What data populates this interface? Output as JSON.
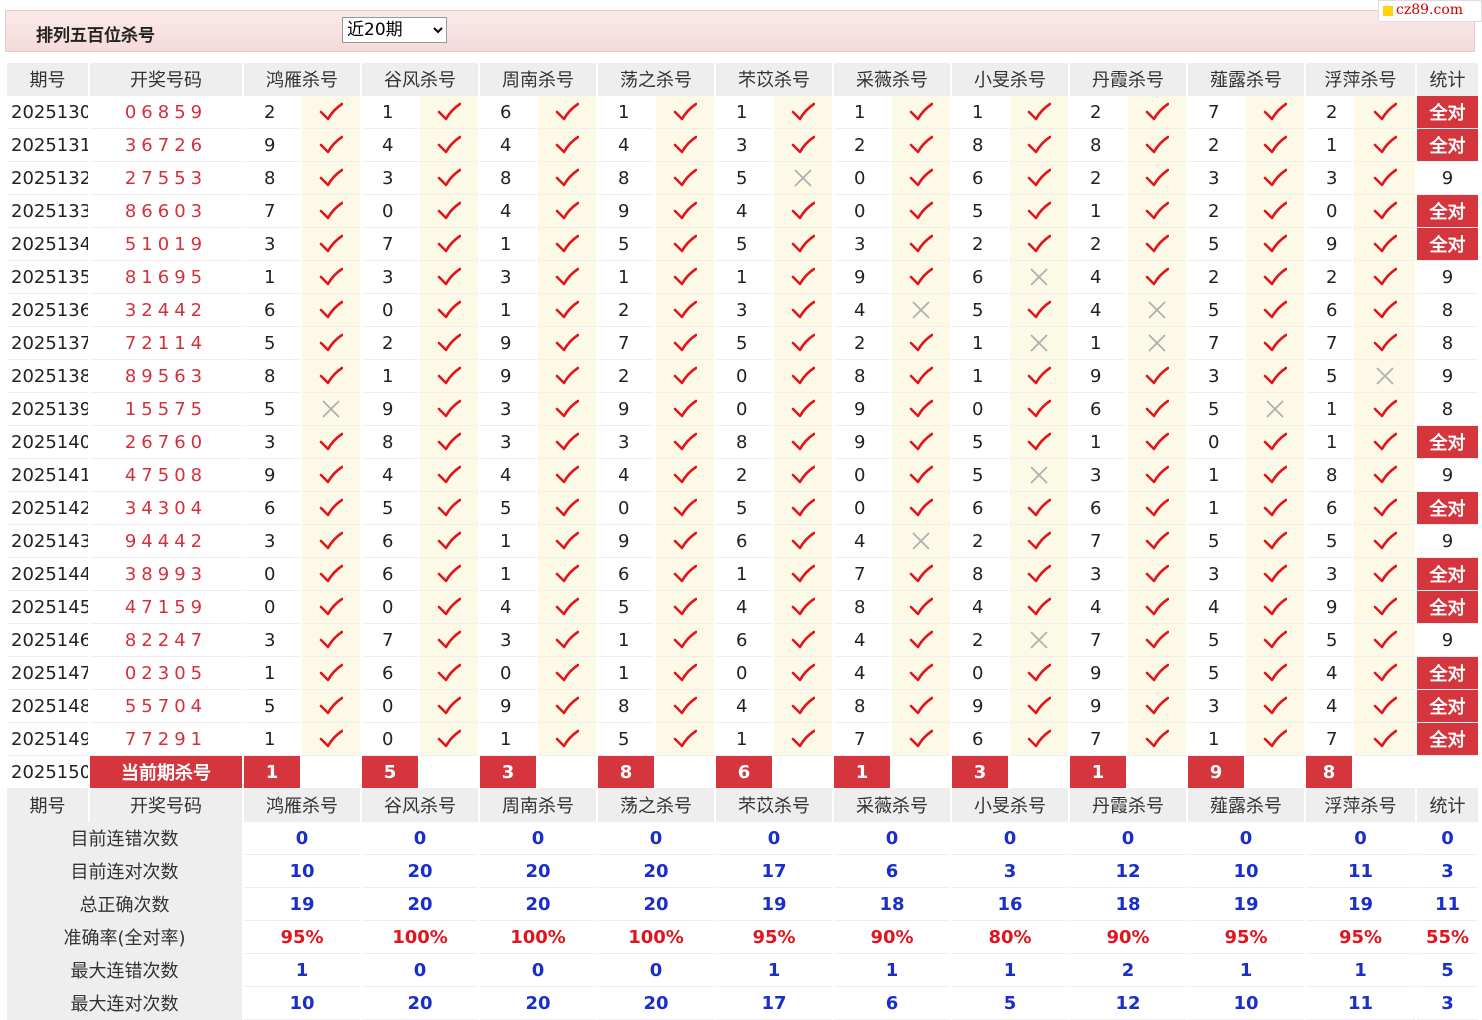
{
  "page": {
    "title": "排列五百位杀号",
    "period_select": "近20期",
    "period_options": [
      "近20期"
    ],
    "logo_text": "cz89.com"
  },
  "headers": [
    "期号",
    "开奖号码",
    "鸿雁杀号",
    "谷风杀号",
    "周南杀号",
    "荡之杀号",
    "芣苡杀号",
    "采薇杀号",
    "小旻杀号",
    "丹霞杀号",
    "薤露杀号",
    "浮萍杀号",
    "统计"
  ],
  "rows": [
    {
      "period": "2025130",
      "draw": "06859",
      "kills": [
        [
          2,
          1
        ],
        [
          1,
          1
        ],
        [
          6,
          1
        ],
        [
          1,
          1
        ],
        [
          1,
          1
        ],
        [
          1,
          1
        ],
        [
          1,
          1
        ],
        [
          2,
          1
        ],
        [
          7,
          1
        ],
        [
          2,
          1
        ]
      ],
      "stat": "全对"
    },
    {
      "period": "2025131",
      "draw": "36726",
      "kills": [
        [
          9,
          1
        ],
        [
          4,
          1
        ],
        [
          4,
          1
        ],
        [
          4,
          1
        ],
        [
          3,
          1
        ],
        [
          2,
          1
        ],
        [
          8,
          1
        ],
        [
          8,
          1
        ],
        [
          2,
          1
        ],
        [
          1,
          1
        ]
      ],
      "stat": "全对"
    },
    {
      "period": "2025132",
      "draw": "27553",
      "kills": [
        [
          8,
          1
        ],
        [
          3,
          1
        ],
        [
          8,
          1
        ],
        [
          8,
          1
        ],
        [
          5,
          0
        ],
        [
          0,
          1
        ],
        [
          6,
          1
        ],
        [
          2,
          1
        ],
        [
          3,
          1
        ],
        [
          3,
          1
        ]
      ],
      "stat": "9"
    },
    {
      "period": "2025133",
      "draw": "86603",
      "kills": [
        [
          7,
          1
        ],
        [
          0,
          1
        ],
        [
          4,
          1
        ],
        [
          9,
          1
        ],
        [
          4,
          1
        ],
        [
          0,
          1
        ],
        [
          5,
          1
        ],
        [
          1,
          1
        ],
        [
          2,
          1
        ],
        [
          0,
          1
        ]
      ],
      "stat": "全对"
    },
    {
      "period": "2025134",
      "draw": "51019",
      "kills": [
        [
          3,
          1
        ],
        [
          7,
          1
        ],
        [
          1,
          1
        ],
        [
          5,
          1
        ],
        [
          5,
          1
        ],
        [
          3,
          1
        ],
        [
          2,
          1
        ],
        [
          2,
          1
        ],
        [
          5,
          1
        ],
        [
          9,
          1
        ]
      ],
      "stat": "全对"
    },
    {
      "period": "2025135",
      "draw": "81695",
      "kills": [
        [
          1,
          1
        ],
        [
          3,
          1
        ],
        [
          3,
          1
        ],
        [
          1,
          1
        ],
        [
          1,
          1
        ],
        [
          9,
          1
        ],
        [
          6,
          0
        ],
        [
          4,
          1
        ],
        [
          2,
          1
        ],
        [
          2,
          1
        ]
      ],
      "stat": "9"
    },
    {
      "period": "2025136",
      "draw": "32442",
      "kills": [
        [
          6,
          1
        ],
        [
          0,
          1
        ],
        [
          1,
          1
        ],
        [
          2,
          1
        ],
        [
          3,
          1
        ],
        [
          4,
          0
        ],
        [
          5,
          1
        ],
        [
          4,
          0
        ],
        [
          5,
          1
        ],
        [
          6,
          1
        ]
      ],
      "stat": "8"
    },
    {
      "period": "2025137",
      "draw": "72114",
      "kills": [
        [
          5,
          1
        ],
        [
          2,
          1
        ],
        [
          9,
          1
        ],
        [
          7,
          1
        ],
        [
          5,
          1
        ],
        [
          2,
          1
        ],
        [
          1,
          0
        ],
        [
          1,
          0
        ],
        [
          7,
          1
        ],
        [
          7,
          1
        ]
      ],
      "stat": "8"
    },
    {
      "period": "2025138",
      "draw": "89563",
      "kills": [
        [
          8,
          1
        ],
        [
          1,
          1
        ],
        [
          9,
          1
        ],
        [
          2,
          1
        ],
        [
          0,
          1
        ],
        [
          8,
          1
        ],
        [
          1,
          1
        ],
        [
          9,
          1
        ],
        [
          3,
          1
        ],
        [
          5,
          0
        ]
      ],
      "stat": "9"
    },
    {
      "period": "2025139",
      "draw": "15575",
      "kills": [
        [
          5,
          0
        ],
        [
          9,
          1
        ],
        [
          3,
          1
        ],
        [
          9,
          1
        ],
        [
          0,
          1
        ],
        [
          9,
          1
        ],
        [
          0,
          1
        ],
        [
          6,
          1
        ],
        [
          5,
          0
        ],
        [
          1,
          1
        ]
      ],
      "stat": "8"
    },
    {
      "period": "2025140",
      "draw": "26760",
      "kills": [
        [
          3,
          1
        ],
        [
          8,
          1
        ],
        [
          3,
          1
        ],
        [
          3,
          1
        ],
        [
          8,
          1
        ],
        [
          9,
          1
        ],
        [
          5,
          1
        ],
        [
          1,
          1
        ],
        [
          0,
          1
        ],
        [
          1,
          1
        ]
      ],
      "stat": "全对"
    },
    {
      "period": "2025141",
      "draw": "47508",
      "kills": [
        [
          9,
          1
        ],
        [
          4,
          1
        ],
        [
          4,
          1
        ],
        [
          4,
          1
        ],
        [
          2,
          1
        ],
        [
          0,
          1
        ],
        [
          5,
          0
        ],
        [
          3,
          1
        ],
        [
          1,
          1
        ],
        [
          8,
          1
        ]
      ],
      "stat": "9"
    },
    {
      "period": "2025142",
      "draw": "34304",
      "kills": [
        [
          6,
          1
        ],
        [
          5,
          1
        ],
        [
          5,
          1
        ],
        [
          0,
          1
        ],
        [
          5,
          1
        ],
        [
          0,
          1
        ],
        [
          6,
          1
        ],
        [
          6,
          1
        ],
        [
          1,
          1
        ],
        [
          6,
          1
        ]
      ],
      "stat": "全对"
    },
    {
      "period": "2025143",
      "draw": "94442",
      "kills": [
        [
          3,
          1
        ],
        [
          6,
          1
        ],
        [
          1,
          1
        ],
        [
          9,
          1
        ],
        [
          6,
          1
        ],
        [
          4,
          0
        ],
        [
          2,
          1
        ],
        [
          7,
          1
        ],
        [
          5,
          1
        ],
        [
          5,
          1
        ]
      ],
      "stat": "9"
    },
    {
      "period": "2025144",
      "draw": "38993",
      "kills": [
        [
          0,
          1
        ],
        [
          6,
          1
        ],
        [
          1,
          1
        ],
        [
          6,
          1
        ],
        [
          1,
          1
        ],
        [
          7,
          1
        ],
        [
          8,
          1
        ],
        [
          3,
          1
        ],
        [
          3,
          1
        ],
        [
          3,
          1
        ]
      ],
      "stat": "全对"
    },
    {
      "period": "2025145",
      "draw": "47159",
      "kills": [
        [
          0,
          1
        ],
        [
          0,
          1
        ],
        [
          4,
          1
        ],
        [
          5,
          1
        ],
        [
          4,
          1
        ],
        [
          8,
          1
        ],
        [
          4,
          1
        ],
        [
          4,
          1
        ],
        [
          4,
          1
        ],
        [
          9,
          1
        ]
      ],
      "stat": "全对"
    },
    {
      "period": "2025146",
      "draw": "82247",
      "kills": [
        [
          3,
          1
        ],
        [
          7,
          1
        ],
        [
          3,
          1
        ],
        [
          1,
          1
        ],
        [
          6,
          1
        ],
        [
          4,
          1
        ],
        [
          2,
          0
        ],
        [
          7,
          1
        ],
        [
          5,
          1
        ],
        [
          5,
          1
        ]
      ],
      "stat": "9"
    },
    {
      "period": "2025147",
      "draw": "02305",
      "kills": [
        [
          1,
          1
        ],
        [
          6,
          1
        ],
        [
          0,
          1
        ],
        [
          1,
          1
        ],
        [
          0,
          1
        ],
        [
          4,
          1
        ],
        [
          0,
          1
        ],
        [
          9,
          1
        ],
        [
          5,
          1
        ],
        [
          4,
          1
        ]
      ],
      "stat": "全对"
    },
    {
      "period": "2025148",
      "draw": "55704",
      "kills": [
        [
          5,
          1
        ],
        [
          0,
          1
        ],
        [
          9,
          1
        ],
        [
          8,
          1
        ],
        [
          4,
          1
        ],
        [
          8,
          1
        ],
        [
          9,
          1
        ],
        [
          9,
          1
        ],
        [
          3,
          1
        ],
        [
          4,
          1
        ]
      ],
      "stat": "全对"
    },
    {
      "period": "2025149",
      "draw": "77291",
      "kills": [
        [
          1,
          1
        ],
        [
          0,
          1
        ],
        [
          1,
          1
        ],
        [
          5,
          1
        ],
        [
          1,
          1
        ],
        [
          7,
          1
        ],
        [
          6,
          1
        ],
        [
          7,
          1
        ],
        [
          1,
          1
        ],
        [
          7,
          1
        ]
      ],
      "stat": "全对"
    }
  ],
  "current": {
    "period": "2025150",
    "label": "当前期杀号",
    "predictions": [
      "1",
      "5",
      "3",
      "8",
      "6",
      "1",
      "3",
      "1",
      "9",
      "8"
    ],
    "stat": ""
  },
  "stats": [
    {
      "label": "目前连错次数",
      "values": [
        "0",
        "0",
        "0",
        "0",
        "0",
        "0",
        "0",
        "0",
        "0",
        "0",
        "0"
      ],
      "kind": "count"
    },
    {
      "label": "目前连对次数",
      "values": [
        "10",
        "20",
        "20",
        "20",
        "17",
        "6",
        "3",
        "12",
        "10",
        "11",
        "3"
      ],
      "kind": "count"
    },
    {
      "label": "总正确次数",
      "values": [
        "19",
        "20",
        "20",
        "20",
        "19",
        "18",
        "16",
        "18",
        "19",
        "19",
        "11"
      ],
      "kind": "count"
    },
    {
      "label": "准确率(全对率)",
      "values": [
        "95%",
        "100%",
        "100%",
        "100%",
        "95%",
        "90%",
        "80%",
        "90%",
        "95%",
        "95%",
        "55%"
      ],
      "kind": "rate"
    },
    {
      "label": "最大连错次数",
      "values": [
        "1",
        "0",
        "0",
        "0",
        "1",
        "1",
        "1",
        "2",
        "1",
        "1",
        "5"
      ],
      "kind": "count"
    },
    {
      "label": "最大连对次数",
      "values": [
        "10",
        "20",
        "20",
        "20",
        "17",
        "6",
        "5",
        "12",
        "10",
        "11",
        "3"
      ],
      "kind": "count"
    }
  ],
  "icons": {
    "correct": "check-icon",
    "wrong": "cross-icon"
  },
  "colors": {
    "accent_red": "#d5353c",
    "check_red": "#e0161e",
    "cross_gray": "#b0b0b0",
    "stat_blue": "#1a2fc8",
    "header_bg": "#eeeeee",
    "mark_bg": "#fcfae6"
  }
}
